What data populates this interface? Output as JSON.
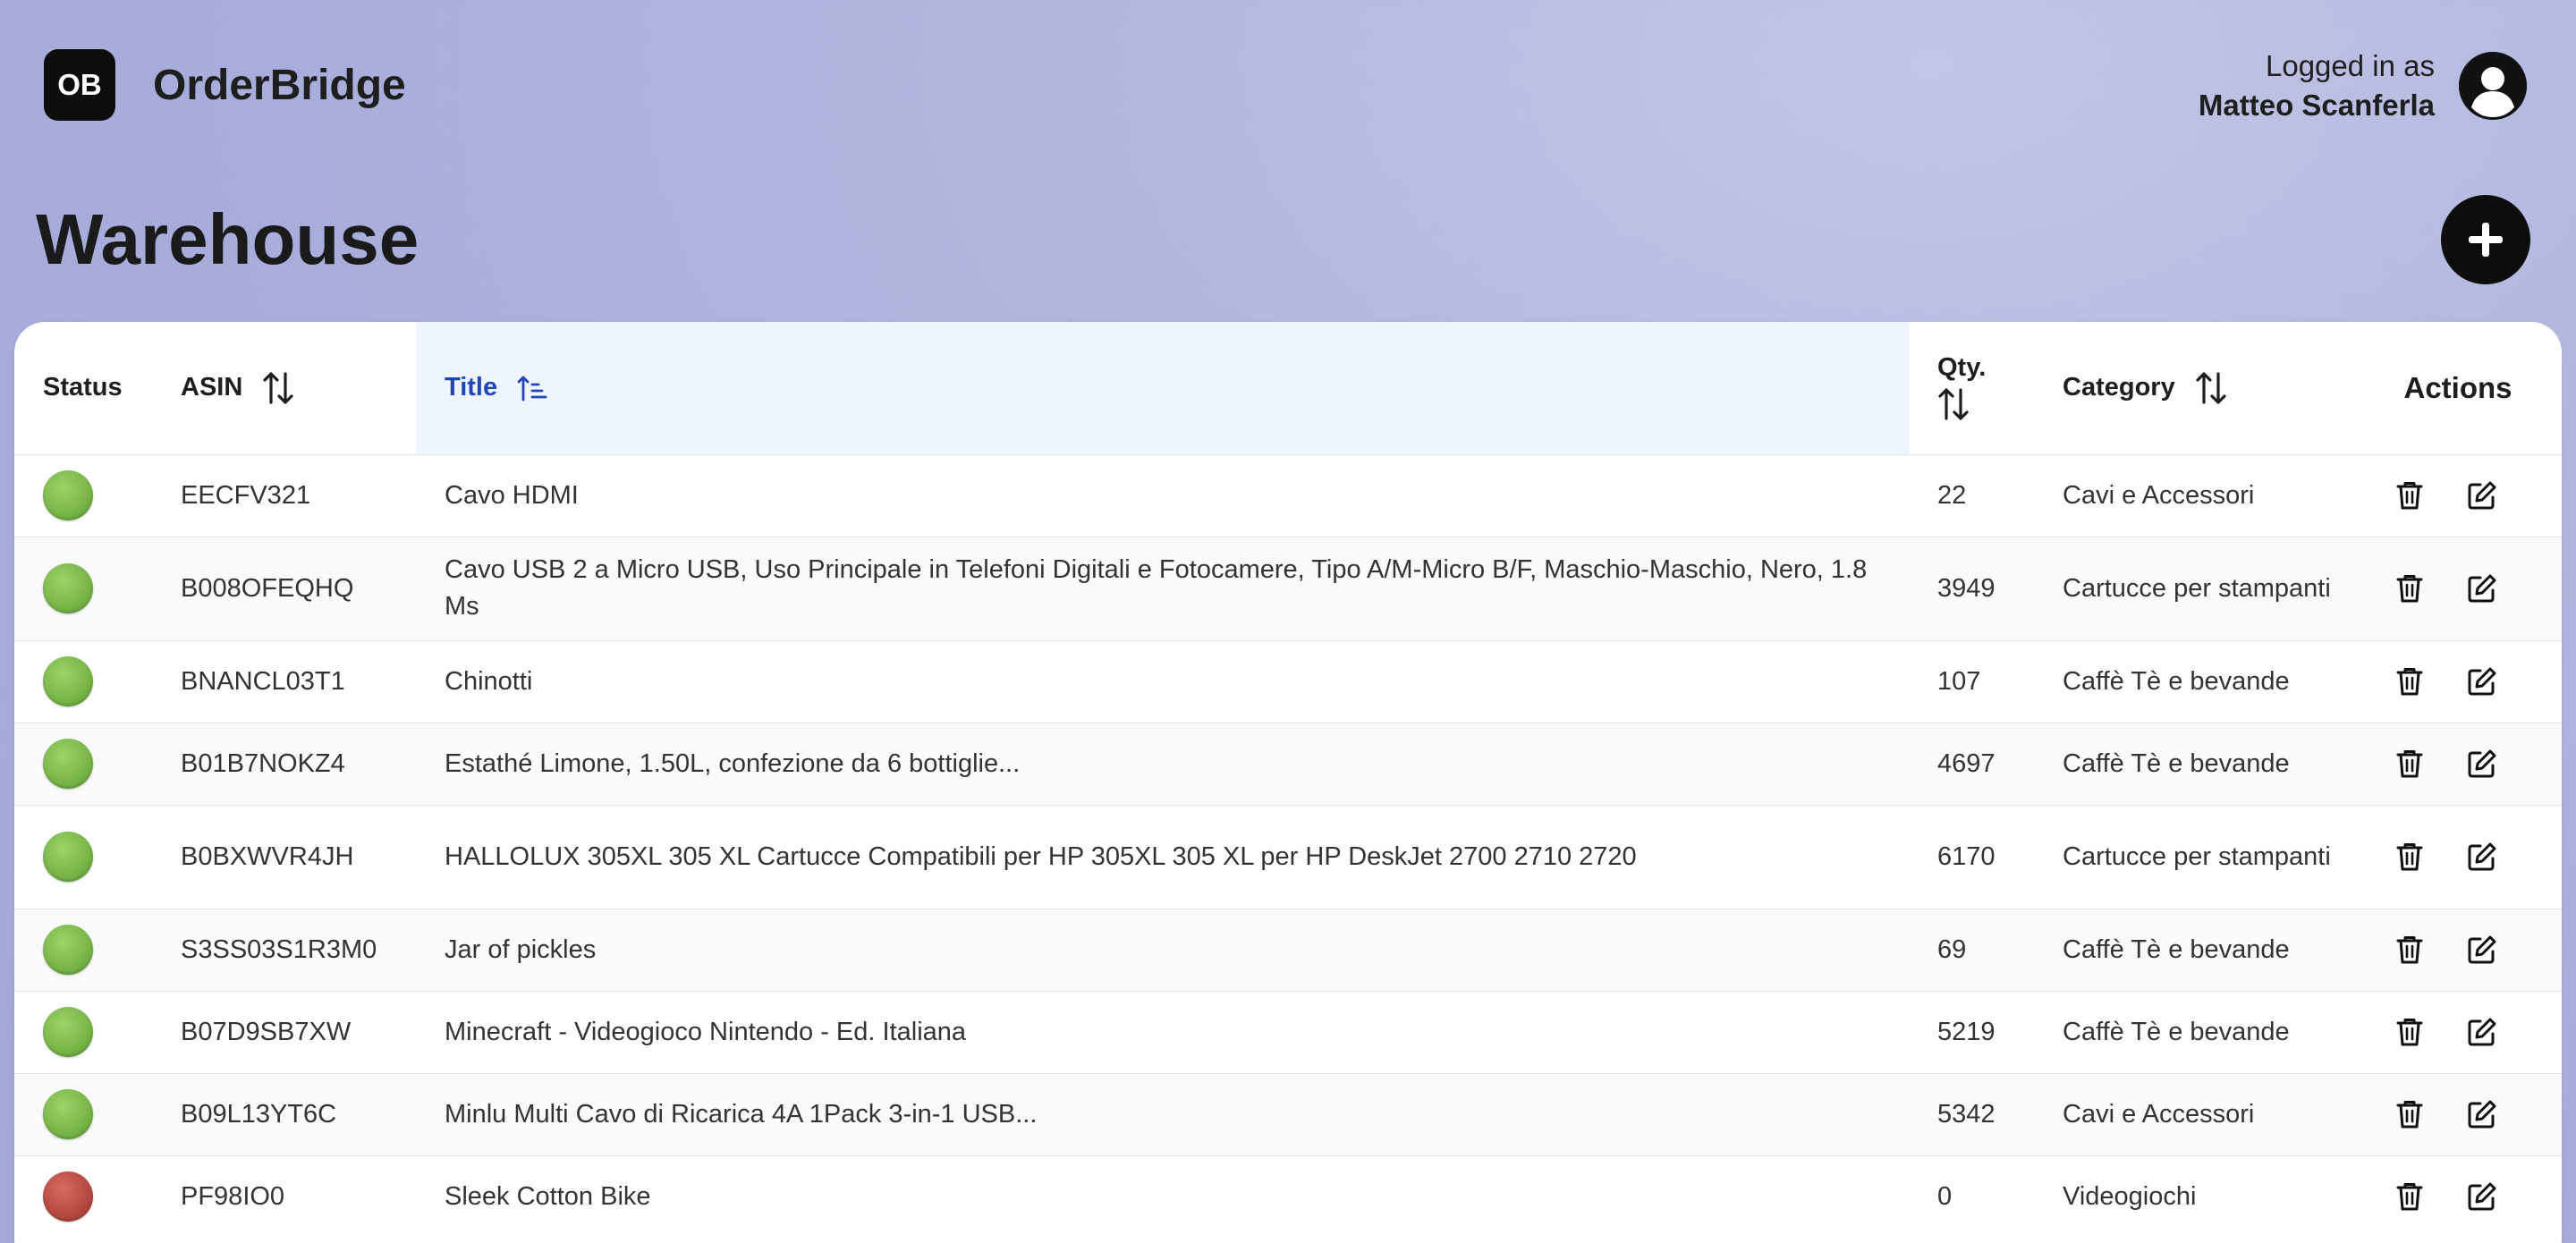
{
  "app": {
    "logo_text": "OB",
    "name": "OrderBridge"
  },
  "user": {
    "caption": "Logged in as",
    "name": "Matteo Scanferla"
  },
  "page": {
    "title": "Warehouse"
  },
  "table": {
    "headers": {
      "status": "Status",
      "asin": "ASIN",
      "title": "Title",
      "qty": "Qty.",
      "category": "Category",
      "actions": "Actions"
    },
    "sorted_column": "title",
    "rows": [
      {
        "status": "green",
        "asin": "EECFV321",
        "title": "Cavo HDMI",
        "qty": "22",
        "category": "Cavi e Accessori"
      },
      {
        "status": "green",
        "asin": "B008OFEQHQ",
        "title": "Cavo USB 2 a Micro USB, Uso Principale in Telefoni Digitali e Fotocamere, Tipo A/M-Micro B/F, Maschio-Maschio, Nero, 1.8 Ms",
        "qty": "3949",
        "category": "Cartucce per stampanti"
      },
      {
        "status": "green",
        "asin": "BNANCL03T1",
        "title": "Chinotti",
        "qty": "107",
        "category": "Caffè Tè e bevande"
      },
      {
        "status": "green",
        "asin": "B01B7NOKZ4",
        "title": "Estathé Limone, 1.50L, confezione da 6 bottiglie...",
        "qty": "4697",
        "category": "Caffè Tè e bevande"
      },
      {
        "status": "green",
        "asin": "B0BXWVR4JH",
        "title": "HALLOLUX 305XL 305 XL Cartucce Compatibili per HP 305XL 305 XL per HP DeskJet 2700 2710 2720",
        "qty": "6170",
        "category": "Cartucce per stampanti"
      },
      {
        "status": "green",
        "asin": "S3SS03S1R3M0",
        "title": "Jar of pickles",
        "qty": "69",
        "category": "Caffè Tè e bevande"
      },
      {
        "status": "green",
        "asin": "B07D9SB7XW",
        "title": "Minecraft - Videogioco Nintendo - Ed. Italiana",
        "qty": "5219",
        "category": "Caffè Tè e bevande"
      },
      {
        "status": "green",
        "asin": "B09L13YT6C",
        "title": "Minlu Multi Cavo di Ricarica 4A 1Pack 3-in-1 USB...",
        "qty": "5342",
        "category": "Cavi e Accessori"
      },
      {
        "status": "red",
        "asin": "PF98IO0",
        "title": "Sleek Cotton Bike",
        "qty": "0",
        "category": "Videogiochi"
      }
    ]
  },
  "colors": {
    "status_green": "#78b548",
    "status_red": "#b44941",
    "sorted_header_text": "#2246b8",
    "sorted_header_bg": "#eef5fd"
  },
  "icons": {
    "logo": "ob-logo-icon",
    "avatar": "user-avatar-icon",
    "add": "plus-icon",
    "sort": "sort-arrows-icon",
    "sort_active": "sort-ascending-icon",
    "delete": "trash-icon",
    "edit": "edit-pencil-icon"
  }
}
